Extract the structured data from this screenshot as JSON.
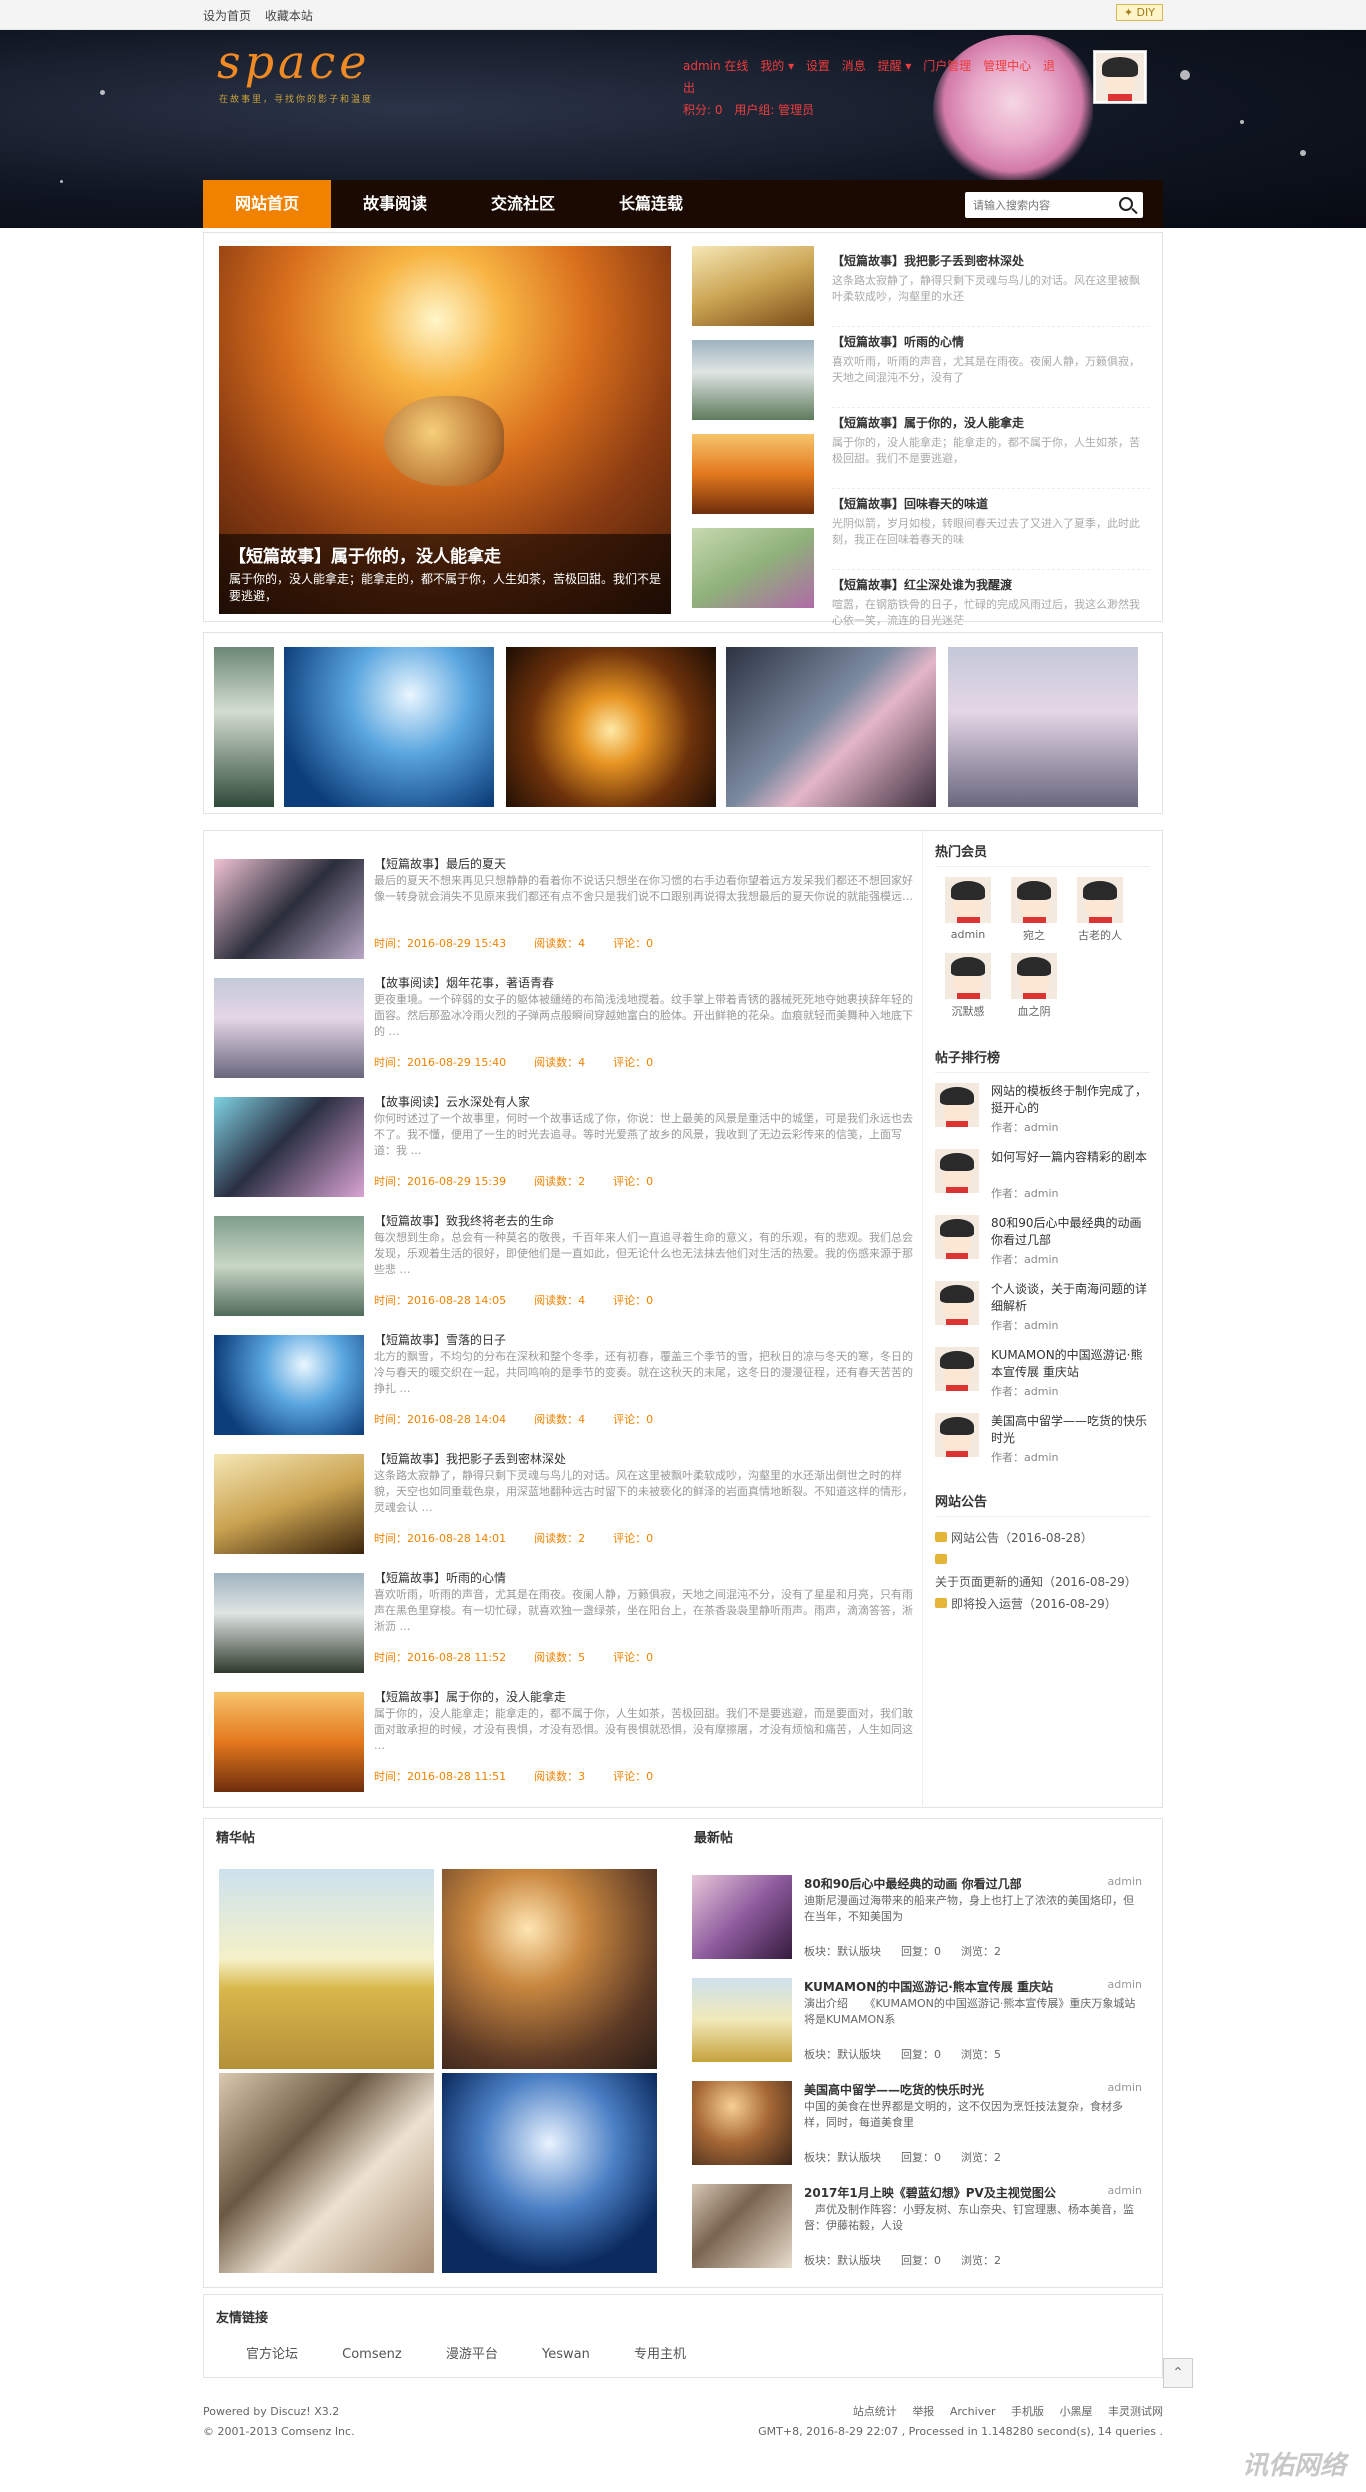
{
  "topbar": {
    "set_home": "设为首页",
    "bookmark": "收藏本站",
    "diy": "✦ DIY"
  },
  "header": {
    "logo": "space",
    "slogan": "在故事里，寻找你的影子和温度",
    "usernav": [
      "admin 在线",
      "我的 ▾",
      "设置",
      "消息",
      "提醒 ▾",
      "门户管理",
      "管理中心",
      "退出",
      "积分: 0",
      "用户组: 管理员"
    ]
  },
  "nav": {
    "items": [
      "网站首页",
      "故事阅读",
      "交流社区",
      "长篇连载"
    ],
    "search_placeholder": "请输入搜索内容"
  },
  "slide": {
    "title": "【短篇故事】属于你的，没人能拿走",
    "desc": "属于你的，没人能拿走；能拿走的，都不属于你，人生如茶，苦极回甜。我们不是要逃避，"
  },
  "side_stories": [
    {
      "title": "【短篇故事】我把影子丢到密林深处",
      "desc": "这条路太寂静了，静得只剩下灵魂与鸟儿的对话。风在这里被飘叶柔软成吵，沟壑里的水还"
    },
    {
      "title": "【短篇故事】听雨的心情",
      "desc": "喜欢听雨，听雨的声音，尤其是在雨夜。夜阑人静，万籁俱寂，天地之间混沌不分，没有了"
    },
    {
      "title": "【短篇故事】属于你的，没人能拿走",
      "desc": "属于你的，没人能拿走；能拿走的，都不属于你，人生如茶，苦极回甜。我们不是要逃避，"
    },
    {
      "title": "【短篇故事】回味春天的味道",
      "desc": "光阴似箭，岁月如梭，转眼间春天过去了又进入了夏季，此时此刻，我正在回味着春天的味"
    },
    {
      "title": "【短篇故事】红尘深处谁为我醒渡",
      "desc": "喧嚣，在钢筋铁骨的日子，忙碌的完成风雨过后，我这么渺然我心依一笑，流连的日光迷茫"
    }
  ],
  "articles": [
    {
      "title": "【短篇故事】最后的夏天",
      "desc": "最后的夏天不想来再见只想静静的看着你不说话只想坐在你习惯的右手边看你望着远方发呆我们都还不想回家好像一转身就会消失不见原来我们都还有点不舍只是我们说不口跟别再说得太我想最后的夏天你说的就能强模远…",
      "time": "时间：2016-08-29 15:43",
      "views": "阅读数：4",
      "comments": "评论：0"
    },
    {
      "title": "【故事阅读】烟年花事，著语青春",
      "desc": "更夜重境。一个碎弱的女子的躯体被缱绻的布简浅浅地搅着。纹手掌上带着青锈的器械死死地夺她裹挟辞年轻的面容。然后那盈冰冷雨火烈的子弹两点般瞬间穿越她富白的脸体。开出鲜艳的花朵。血痕就轻而美舞种入地底下的 …",
      "time": "时间：2016-08-29 15:40",
      "views": "阅读数：4",
      "comments": "评论：0"
    },
    {
      "title": "【故事阅读】云水深处有人家",
      "desc": "你何时述过了一个故事里，何时一个故事话成了你，你说：世上最美的风景是重活中的城堡，可是我们永远也去不了。我不懂，便用了一生的时光去追寻。等时光爱燕了故乡的风景，我收到了无边云彩传来的信笺，上面写道：我 …",
      "time": "时间：2016-08-29 15:39",
      "views": "阅读数：2",
      "comments": "评论：0"
    },
    {
      "title": "【短篇故事】致我终将老去的生命",
      "desc": "每次想到生命，总会有一种莫名的敬畏，千百年来人们一直追寻着生命的意义，有的乐观，有的悲观。我们总会发现，乐观着生活的很好，即使他们是一直如此，但无论什么也无法抹去他们对生活的热爱。我的伤感来源于那些悲 …",
      "time": "时间：2016-08-28 14:05",
      "views": "阅读数：4",
      "comments": "评论：0"
    },
    {
      "title": "【短篇故事】雪落的日子",
      "desc": "北方的飘雪，不均匀的分布在深秋和整个冬季，还有初春，覆盖三个季节的雪，把秋日的凉与冬天的寒，冬日的冷与春天的暖交织在一起，共同鸣响的是季节的变奏。就在这秋天的末尾，这冬日的漫漫征程，还有春天苦苦的挣扎 …",
      "time": "时间：2016-08-28 14:04",
      "views": "阅读数：4",
      "comments": "评论：0"
    },
    {
      "title": "【短篇故事】我把影子丢到密林深处",
      "desc": "这条路太寂静了，静得只剩下灵魂与鸟儿的对话。风在这里被飘叶柔软成吵，沟壑里的水还渐出倒世之时的样貌，天空也如同重载色泉，用深蓝地翻种远古时留下的未被亵化的鲜泽的岩面真情地断裂。不知道这样的情形，灵魂会认 …",
      "time": "时间：2016-08-28 14:01",
      "views": "阅读数：2",
      "comments": "评论：0"
    },
    {
      "title": "【短篇故事】听雨的心情",
      "desc": "喜欢听雨，听雨的声音，尤其是在雨夜。夜阑人静，万籁俱寂，天地之间混沌不分，没有了星星和月亮，只有雨声在黑色里穿梭。有一切忙碌，就喜欢独一盏绿茶，坐在阳台上，在茶香袅袅里静听雨声。雨声，滴滴答答，淅淅沥 …",
      "time": "时间：2016-08-28 11:52",
      "views": "阅读数：5",
      "comments": "评论：0"
    },
    {
      "title": "【短篇故事】属于你的，没人能拿走",
      "desc": "属于你的，没人能拿走；能拿走的，都不属于你，人生如茶，苦极回甜。我们不是要逃避，而是要面对，我们敢面对敢承担的时候，才没有畏惧，才没有恐惧。没有畏惧就恐惧，没有摩擦屠，才没有烦恼和痛苦，人生如同这 …",
      "time": "时间：2016-08-28 11:51",
      "views": "阅读数：3",
      "comments": "评论：0"
    }
  ],
  "sidebar": {
    "hot_members_title": "热门会员",
    "members": [
      "admin",
      "宛之",
      "古老的人",
      "沉默感",
      "血之阴"
    ],
    "rank_title": "帖子排行榜",
    "ranks": [
      {
        "title": "网站的模板终于制作完成了，挺开心的",
        "author": "作者：admin"
      },
      {
        "title": "如何写好一篇内容精彩的剧本",
        "author": "作者：admin"
      },
      {
        "title": "80和90后心中最经典的动画你看过几部",
        "author": "作者：admin"
      },
      {
        "title": "个人谈谈，关于南海问题的详细解析",
        "author": "作者：admin"
      },
      {
        "title": "KUMAMON的中国巡游记·熊本宣传展 重庆站",
        "author": "作者：admin"
      },
      {
        "title": "美国高中留学——吃货的快乐时光",
        "author": "作者：admin"
      }
    ],
    "notice_title": "网站公告",
    "notices": [
      "网站公告（2016-08-28）",
      "关于页面更新的通知（2016-08-29）",
      "即将投入运营（2016-08-29）"
    ]
  },
  "bottom": {
    "featured_title": "精华帖",
    "latest_title": "最新帖",
    "latest": [
      {
        "title": "80和90后心中最经典的动画 你看过几部",
        "author": "admin",
        "desc": "迪斯尼漫画过海带来的船来产物，身上也打上了浓浓的美国烙印，但在当年，不知美国为",
        "board": "板块：默认版块",
        "replies": "回复：0",
        "views": "浏览：2"
      },
      {
        "title": "KUMAMON的中国巡游记·熊本宣传展 重庆站",
        "author": "admin",
        "desc": "演出介绍　　《KUMAMON的中国巡游记·熊本宣传展》重庆万象城站将是KUMAMON系",
        "board": "板块：默认版块",
        "replies": "回复：0",
        "views": "浏览：5"
      },
      {
        "title": "美国高中留学——吃货的快乐时光",
        "author": "admin",
        "desc": "中国的美食在世界都是文明的，这不仅因为烹饪技法复杂，食材多样，同时，每道美食里",
        "board": "板块：默认版块",
        "replies": "回复：0",
        "views": "浏览：2"
      },
      {
        "title": "2017年1月上映《碧蓝幻想》PV及主视觉图公",
        "author": "admin",
        "desc": "　声优及制作阵容：小野友树、东山奈央、钉宫理惠、杨本美音，监督：伊藤祐毅，人设",
        "board": "板块：默认版块",
        "replies": "回复：0",
        "views": "浏览：2"
      }
    ]
  },
  "links": {
    "title": "友情链接",
    "items": [
      "官方论坛",
      "Comsenz",
      "漫游平台",
      "Yeswan",
      "专用主机"
    ]
  },
  "footer": {
    "powered": "Powered by Discuz! X3.2",
    "copyright": "© 2001-2013 Comsenz Inc.",
    "right_links": [
      "站点统计",
      "举报",
      "Archiver",
      "手机版",
      "小黑屋",
      "丰灵测试网"
    ],
    "gmt": "GMT+8, 2016-8-29 22:07 , Processed in 1.148280 second(s), 14 queries ."
  },
  "watermark": "讯佑网络"
}
